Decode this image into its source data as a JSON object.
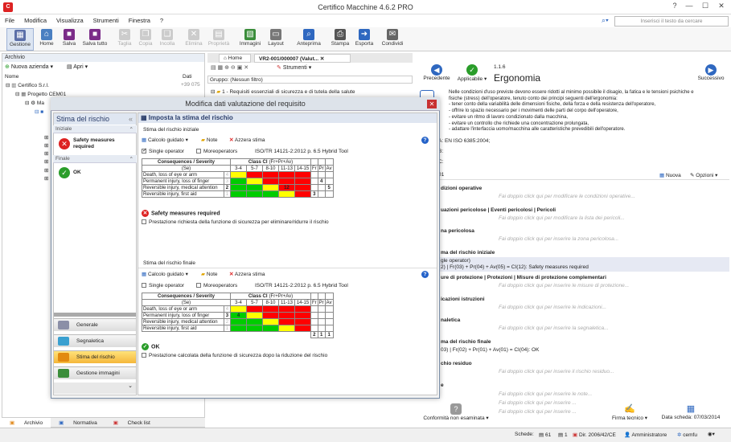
{
  "window": {
    "title": "Certifico Macchine 4.6.2 PRO",
    "help": "?",
    "minimize": "—",
    "maximize": "☐",
    "close": "✕"
  },
  "menu": [
    "File",
    "Modifica",
    "Visualizza",
    "Strumenti",
    "Finestra",
    "?"
  ],
  "search": {
    "placeholder": "Inserisci il testo da cercare"
  },
  "ribbon": [
    {
      "label": "Gestione",
      "color": "#5b6fa8",
      "glyph": "▦",
      "enabled": true
    },
    {
      "label": "Home",
      "color": "#4a7fc1",
      "glyph": "⌂",
      "enabled": true
    },
    {
      "label": "Salva",
      "color": "#7b2c88",
      "glyph": "■",
      "enabled": true
    },
    {
      "label": "Salva tutto",
      "color": "#7b2c88",
      "glyph": "■",
      "enabled": true
    },
    {
      "label": "Taglia",
      "color": "#999",
      "glyph": "✂",
      "enabled": false
    },
    {
      "label": "Copia",
      "color": "#999",
      "glyph": "❐",
      "enabled": false
    },
    {
      "label": "Incolla",
      "color": "#999",
      "glyph": "❑",
      "enabled": false
    },
    {
      "label": "Elimina",
      "color": "#999",
      "glyph": "✕",
      "enabled": false
    },
    {
      "label": "Proprietà",
      "color": "#999",
      "glyph": "▤",
      "enabled": false
    },
    {
      "label": "Immagini",
      "color": "#3b8d3b",
      "glyph": "▧",
      "enabled": true
    },
    {
      "label": "Layout",
      "color": "#777",
      "glyph": "▭",
      "enabled": true
    },
    {
      "label": "Anteprima",
      "color": "#2f68c0",
      "glyph": "⌕",
      "enabled": true
    },
    {
      "label": "Stampa",
      "color": "#555",
      "glyph": "⎙",
      "enabled": true
    },
    {
      "label": "Esporta",
      "color": "#2f68c0",
      "glyph": "➜",
      "enabled": true
    },
    {
      "label": "Condividi",
      "color": "#666",
      "glyph": "✉",
      "enabled": true
    }
  ],
  "archive": {
    "title": "Archivio",
    "new_company": "Nuova azienda",
    "open": "Apri",
    "col_name": "Nome",
    "col_data": "Dati",
    "tree": [
      {
        "label": "Certifico S.r.l.",
        "value": "+39 075"
      },
      {
        "label": "Progetto CEM01",
        "value": ""
      },
      {
        "label": "Ma",
        "value": ""
      }
    ]
  },
  "bottom_tabs": [
    "Archivio",
    "Normativa",
    "Check list"
  ],
  "doc_tabs": [
    "Home",
    "VR2-001/000007 (Valut..."
  ],
  "doc_toolbar": {
    "tools": "Strumenti",
    "group": "Gruppo: (Nessun filtro)",
    "row1": "1 - Requisiti essenziali di sicurezza e di tutela della salute"
  },
  "right": {
    "prev": "Precedente",
    "applicable": "Applicabile",
    "next": "Successivo",
    "code": "1.1.6",
    "title": "Ergonomia",
    "description": [
      "Nelle condizioni d'uso previste devono essere ridotti al minimo possibile il disagio, la fatica e le tensioni psichiche e",
      "fisiche (stress) dell'operatore, tenuto conto dei principi seguenti dell'ergonomia:",
      "- tener conto della variabilità delle dimensioni fisiche, della forza e della resistenza dell'operatore,",
      "- offrire lo spazio necessario per i movimenti delle parti del corpo dell'operatore,",
      "- evitare un ritmo di lavoro condizionato dalla macchina,",
      "- evitare un controllo che richiede una concentrazione prolungata,",
      "- adattare l'interfaccia uomo/macchina alle caratteristiche prevedibili dell'operatore."
    ],
    "refs": [
      "A: EN ISO 6385:2004;",
      "B:",
      "C:"
    ],
    "tab01": "01",
    "new": "Nuova",
    "options": "Opzioni",
    "sections": [
      {
        "title": "dizioni operative",
        "hint": "Fai doppio click qui per modificare le condizioni operative..."
      },
      {
        "title": "uazioni pericolose | Eventi pericolosi | Pericoli",
        "hint": "Fai doppio click qui per modificare la lista dei pericoli..."
      },
      {
        "title": "na pericolosa",
        "hint": "Fai doppio click qui per inserire la zona pericolosa..."
      },
      {
        "title": "ma del rischio iniziale",
        "hint": ""
      },
      {
        "title": "ure di protezione | Protezioni | Misure di protezione complementari",
        "hint": "Fai doppio click qui per inserire le misure di protezione..."
      },
      {
        "title": "icazioni istruzioni",
        "hint": "Fai doppio click qui per inserire le indicazioni..."
      },
      {
        "title": "naletica",
        "hint": "Fai doppio click qui per inserire la segnaletica..."
      },
      {
        "title": "ma del rischio finale",
        "hint": ""
      },
      {
        "title": "chio residuo",
        "hint": "Fai doppio click qui per inserire il rischio residuo..."
      },
      {
        "title": "e",
        "hint": "Fai doppio click qui per inserire le note..."
      }
    ],
    "initial_line1": "gle operator)",
    "initial_line2": "2) | Fr(03) + Pr(04) + Av(05) = CI(12): Safety measures required",
    "final_line": "03) | Fr(02) + Pr(01) + Av(01) = CI(04): OK",
    "extra_hint_1": "Fai doppio click qui per inserire ...",
    "extra_hint_2": "Fai doppio click qui per inserire ...",
    "footer_conformity": "Conformità non esaminata",
    "footer_signature": "Firma tecnico",
    "footer_date": "Data scheda: 07/03/2014"
  },
  "modal": {
    "title": "Modifica dati valutazione del requisito",
    "nav_title": "Stima del rischio",
    "initial_hdr": "Iniziale",
    "initial_status": "Safety measures required",
    "final_hdr": "Finale",
    "final_status": "OK",
    "nav_buttons": [
      "Generale",
      "Segnaletica",
      "Stima del rischio",
      "Gestione immagini"
    ],
    "panel_title": "Imposta la stima del rischio",
    "initial_title": "Stima del rischio iniziale",
    "final_title": "Stima del rischio finale",
    "guided": "Calcolo guidato",
    "note": "Note",
    "reset": "Azzera stima",
    "single": "Single operator",
    "more": "Moreoperators",
    "tool": "ISO/TR 14121-2:2012 p. 6.5 Hybrid Tool",
    "hdr_cons": "Consequences / Severity",
    "hdr_se": "(Se)",
    "hdr_class": "Class CI",
    "hdr_class_sub": "(Fr+Pr+Av)",
    "classes": [
      "3-4",
      "5-7",
      "8-10",
      "11-13",
      "14-15"
    ],
    "fpa": [
      "Fr",
      "Pr",
      "Av"
    ],
    "severities": [
      "Death, loss of eye or arm",
      "Permanent injury, loss of finger",
      "Reversible injury, medical attention",
      "Reversible injury, first aid"
    ],
    "sev_scores": [
      "4",
      "3",
      "2",
      "1"
    ],
    "init_selected_sev": "2",
    "init_mark": "12",
    "init_fpa": [
      [
        "",
        "",
        ""
      ],
      [
        "",
        "4",
        ""
      ],
      [
        "",
        "",
        "5"
      ],
      [
        "3",
        "",
        ""
      ]
    ],
    "init_result": "Safety measures required",
    "init_note": "Prestazione richiesta della funzione di sicurezza per eliminare/ridurre il rischio",
    "final_selected_sev": "3",
    "final_mark": "4",
    "final_fpa": [
      [
        "",
        "",
        ""
      ],
      [
        "",
        "",
        ""
      ],
      [
        "",
        "",
        ""
      ],
      [
        "",
        "",
        ""
      ]
    ],
    "final_totals": [
      "2",
      "1",
      "1"
    ],
    "final_result": "OK",
    "final_note": "Prestazione calcolata della funzione di sicurezza dopo la riduzione del rischio"
  },
  "statusbar": {
    "schede": "Schede:",
    "n1": "61",
    "n2": "1",
    "directive": "Dir. 2006/42/CE",
    "user": "Amministratore",
    "org": "cemfu"
  },
  "colors": {
    "yellow": "#ffff00",
    "red": "#ff0000",
    "green": "#00cc00",
    "accent": "#2f68c0"
  }
}
